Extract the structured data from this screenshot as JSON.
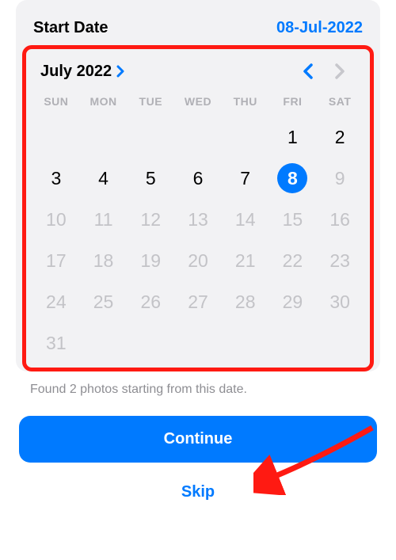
{
  "header": {
    "label": "Start Date",
    "value": "08-Jul-2022"
  },
  "calendar": {
    "month_label": "July 2022",
    "days_of_week": [
      "SUN",
      "MON",
      "TUE",
      "WED",
      "THU",
      "FRI",
      "SAT"
    ],
    "cells": [
      {
        "n": "",
        "state": "blank"
      },
      {
        "n": "",
        "state": "blank"
      },
      {
        "n": "",
        "state": "blank"
      },
      {
        "n": "",
        "state": "blank"
      },
      {
        "n": "",
        "state": "blank"
      },
      {
        "n": "1",
        "state": "active"
      },
      {
        "n": "2",
        "state": "active"
      },
      {
        "n": "3",
        "state": "active"
      },
      {
        "n": "4",
        "state": "active"
      },
      {
        "n": "5",
        "state": "active"
      },
      {
        "n": "6",
        "state": "active"
      },
      {
        "n": "7",
        "state": "active"
      },
      {
        "n": "8",
        "state": "selected"
      },
      {
        "n": "9",
        "state": "disabled"
      },
      {
        "n": "10",
        "state": "disabled"
      },
      {
        "n": "11",
        "state": "disabled"
      },
      {
        "n": "12",
        "state": "disabled"
      },
      {
        "n": "13",
        "state": "disabled"
      },
      {
        "n": "14",
        "state": "disabled"
      },
      {
        "n": "15",
        "state": "disabled"
      },
      {
        "n": "16",
        "state": "disabled"
      },
      {
        "n": "17",
        "state": "disabled"
      },
      {
        "n": "18",
        "state": "disabled"
      },
      {
        "n": "19",
        "state": "disabled"
      },
      {
        "n": "20",
        "state": "disabled"
      },
      {
        "n": "21",
        "state": "disabled"
      },
      {
        "n": "22",
        "state": "disabled"
      },
      {
        "n": "23",
        "state": "disabled"
      },
      {
        "n": "24",
        "state": "disabled"
      },
      {
        "n": "25",
        "state": "disabled"
      },
      {
        "n": "26",
        "state": "disabled"
      },
      {
        "n": "27",
        "state": "disabled"
      },
      {
        "n": "28",
        "state": "disabled"
      },
      {
        "n": "29",
        "state": "disabled"
      },
      {
        "n": "30",
        "state": "disabled"
      },
      {
        "n": "31",
        "state": "disabled"
      }
    ]
  },
  "status_text": "Found 2 photos starting from this date.",
  "buttons": {
    "continue": "Continue",
    "skip": "Skip"
  },
  "colors": {
    "accent": "#007aff",
    "highlight_border": "#ff1a12"
  }
}
